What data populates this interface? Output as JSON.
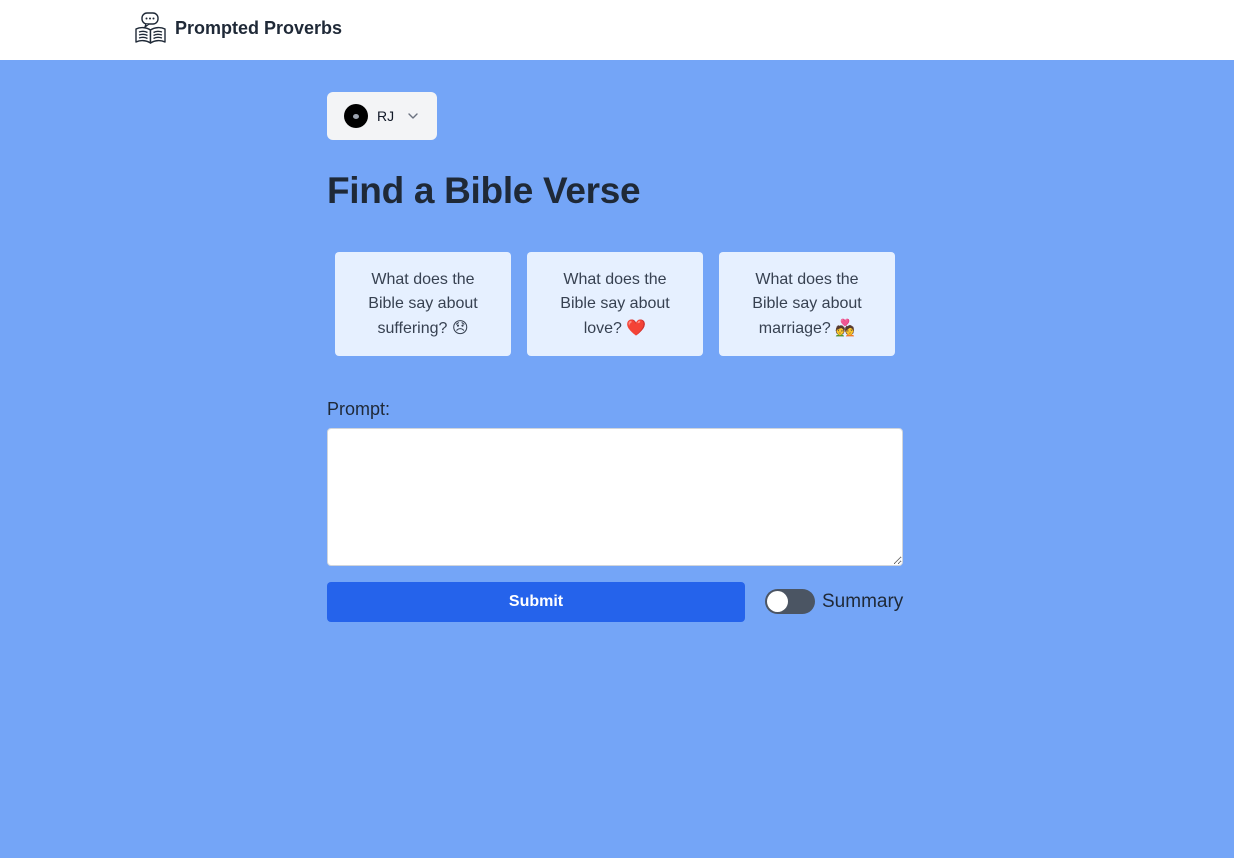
{
  "header": {
    "brand_name": "Prompted Proverbs",
    "brand_icon": "open-book-speech-bubble-icon"
  },
  "user_menu": {
    "initials": "RJ",
    "icon": "chevron-down-icon"
  },
  "page": {
    "title": "Find a Bible Verse"
  },
  "suggestions": [
    {
      "text": "What does the Bible say about suffering?",
      "emoji": "😞"
    },
    {
      "text": "What does the Bible say about love?",
      "emoji": "❤️"
    },
    {
      "text": "What does the Bible say about marriage?",
      "emoji": "💑"
    }
  ],
  "form": {
    "prompt_label": "Prompt:",
    "prompt_value": "",
    "submit_label": "Submit",
    "summary_label": "Summary",
    "summary_enabled": false
  },
  "colors": {
    "background": "#74a5f7",
    "accent": "#2563eb",
    "card": "#e6f0ff"
  }
}
